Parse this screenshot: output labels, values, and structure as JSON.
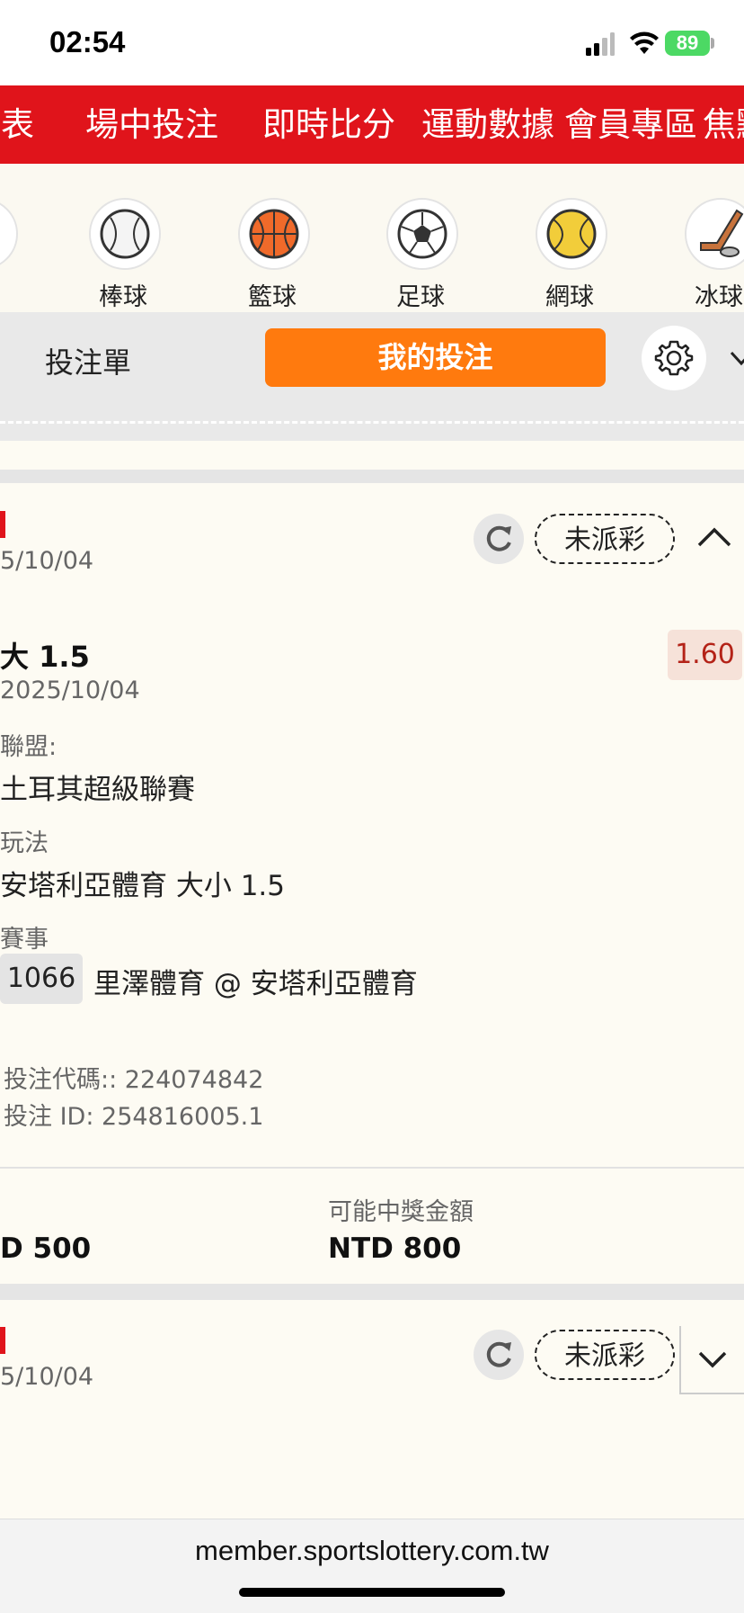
{
  "status_bar": {
    "time": "02:54",
    "battery": "89"
  },
  "top_nav": {
    "items": [
      "賽表",
      "場中投注",
      "即時比分",
      "運動數據",
      "會員專區",
      "焦點"
    ]
  },
  "sports": {
    "items": [
      {
        "label": "棒球",
        "icon": "baseball-icon"
      },
      {
        "label": "籃球",
        "icon": "basketball-icon"
      },
      {
        "label": "足球",
        "icon": "soccer-icon"
      },
      {
        "label": "網球",
        "icon": "tennis-icon"
      },
      {
        "label": "冰球",
        "icon": "hockey-icon"
      }
    ]
  },
  "bet_tabs": {
    "betslip": "投注單",
    "mybets": "我的投注"
  },
  "card1": {
    "date": "5/10/04",
    "status": "未派彩",
    "selection": "大 1.5",
    "odds": "1.60",
    "match_date": "2025/10/04",
    "league_label": "聯盟:",
    "league": "土耳其超級聯賽",
    "market_label": "玩法",
    "market": "安塔利亞體育 大小 1.5",
    "event_label": "賽事",
    "event_id": "1066",
    "event_name": "里澤體育 @ 安塔利亞體育",
    "bet_code": "投注代碼:: 224074842",
    "bet_id": "投注 ID: 254816005.1",
    "stake": "D 500",
    "payout_label": "可能中獎金額",
    "payout": "NTD 800"
  },
  "card2": {
    "date": "5/10/04",
    "status": "未派彩"
  },
  "browser": {
    "url": "member.sportslottery.com.tw"
  },
  "colors": {
    "brand_red": "#e0141b",
    "accent_orange": "#ff7a0e",
    "odds_red": "#b42318"
  }
}
